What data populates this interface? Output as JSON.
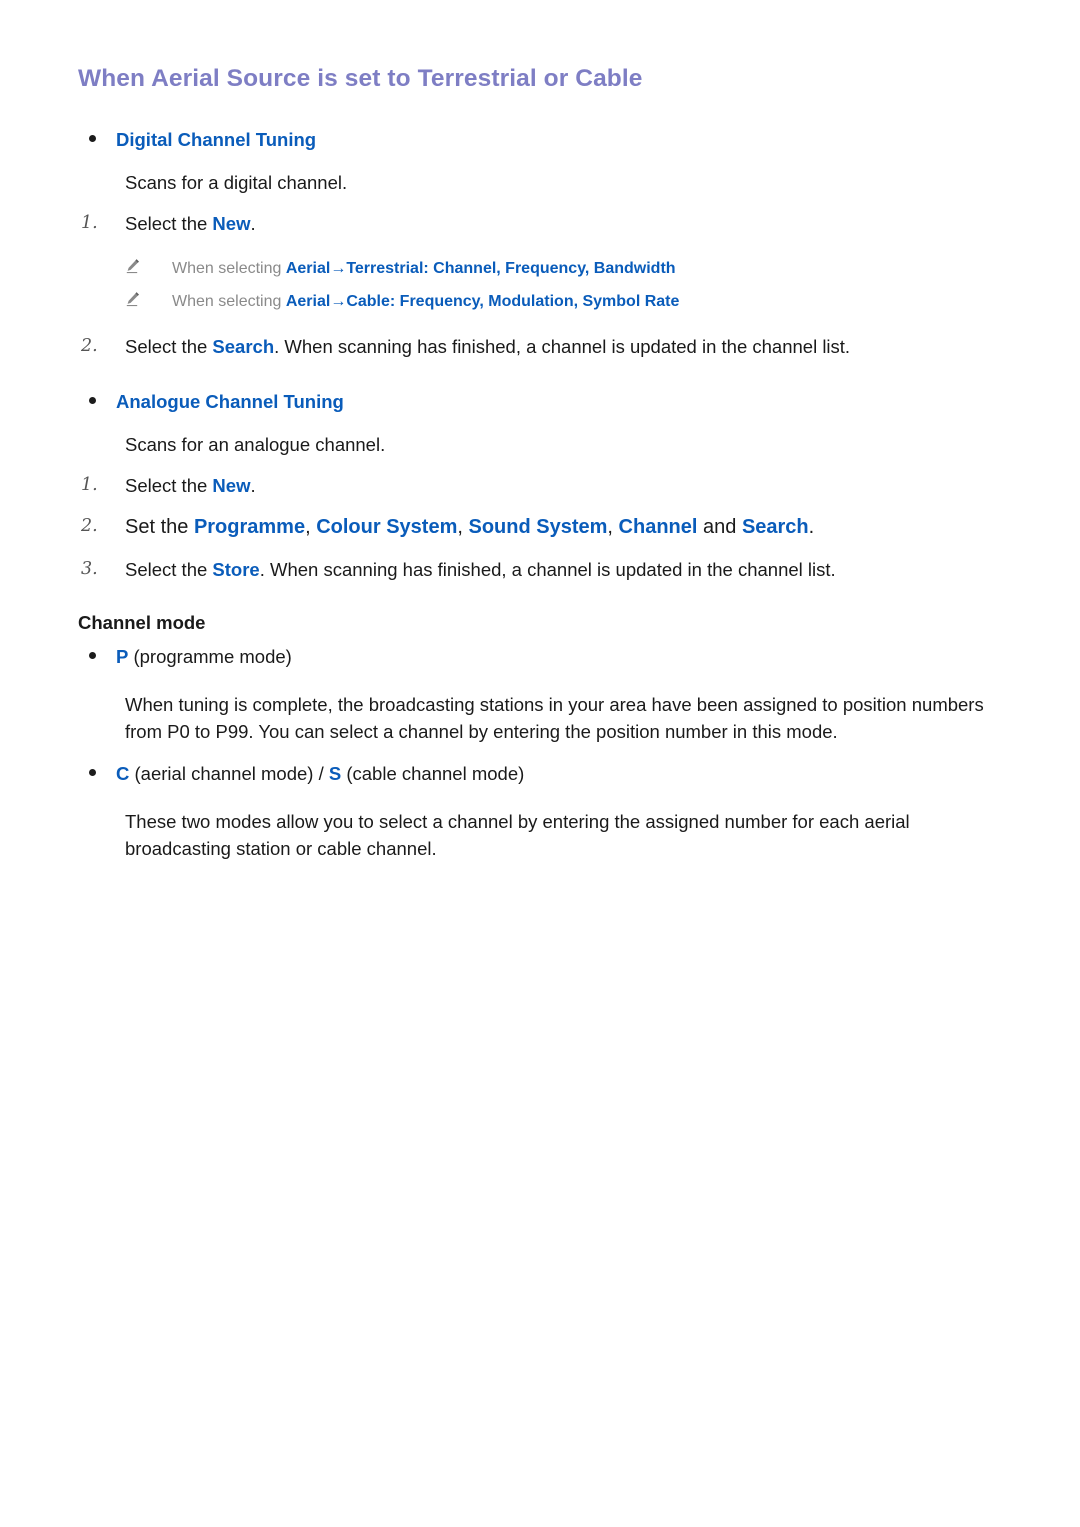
{
  "page": {
    "title": "When Aerial Source is set to Terrestrial or Cable"
  },
  "colors": {
    "title_purple": "#7e7ec4",
    "link_blue": "#0a5cba",
    "note_gray": "#8a8a8a",
    "body_text": "#1a1a1a",
    "step_number": "#555555"
  },
  "digital": {
    "bullet_label": "Digital Channel Tuning",
    "description": "Scans for a digital channel.",
    "step1": {
      "number": "1.",
      "prefix": "Select the ",
      "keyword": "New",
      "suffix": "."
    },
    "notes": [
      {
        "icon": "pencil-icon",
        "lead": "When selecting ",
        "source": "Aerial",
        "arrow": "→",
        "target": "Terrestrial",
        "colon": ":",
        "options": " Channel, Frequency, Bandwidth",
        "options_list": [
          "Channel",
          "Frequency",
          "Bandwidth"
        ]
      },
      {
        "icon": "pencil-icon",
        "lead": "When selecting ",
        "source": "Aerial",
        "arrow": "→",
        "target": "Cable",
        "colon": ":",
        "options": " Frequency, Modulation, Symbol Rate",
        "options_list": [
          "Frequency",
          "Modulation",
          "Symbol Rate"
        ]
      }
    ],
    "step2": {
      "number": "2.",
      "prefix": "Select the ",
      "keyword": "Search",
      "suffix": ". When scanning has finished, a channel is updated in the channel list."
    }
  },
  "analogue": {
    "bullet_label": "Analogue Channel Tuning",
    "description": "Scans for an analogue channel.",
    "step1": {
      "number": "1.",
      "prefix": "Select the ",
      "keyword": "New",
      "suffix": "."
    },
    "step2": {
      "number": "2.",
      "prefix": "Set the ",
      "k1": "Programme",
      "sep1": ", ",
      "k2": "Colour System",
      "sep2": ", ",
      "k3": "Sound System",
      "sep3": ", ",
      "k4": "Channel",
      "mid": " and ",
      "k5": "Search",
      "suffix": "."
    },
    "step3": {
      "number": "3.",
      "prefix": "Select the ",
      "keyword": "Store",
      "suffix": ". When scanning has finished, a channel is updated in the channel list."
    }
  },
  "channel_mode": {
    "heading": "Channel mode",
    "p_mode": {
      "keyword": "P",
      "label": " (programme mode)",
      "paragraph": "When tuning is complete, the broadcasting stations in your area have been assigned to position numbers from P0 to P99. You can select a channel by entering the position number in this mode."
    },
    "cs_mode": {
      "keyword_c": "C",
      "label_c": " (aerial channel mode) ",
      "slash": "/ ",
      "keyword_s": "S",
      "label_s": " (cable channel mode)",
      "paragraph": "These two modes allow you to select a channel by entering the assigned number for each aerial broadcasting station or cable channel."
    }
  }
}
